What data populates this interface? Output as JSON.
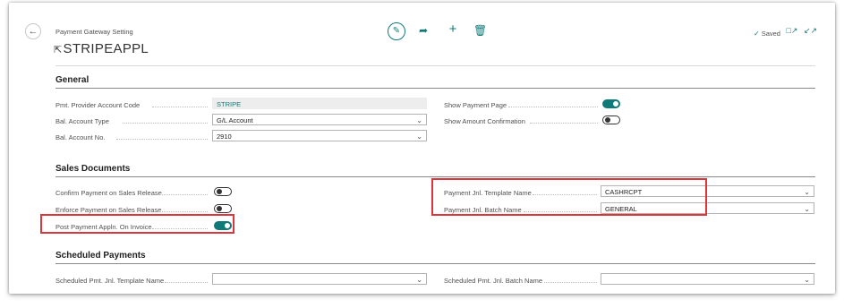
{
  "header": {
    "page_caption": "Payment Gateway Setting",
    "record_title": "STRIPEAPPL",
    "saved_text": "Saved",
    "icons": [
      "back-arrow-icon",
      "edit-icon",
      "share-icon",
      "add-icon",
      "delete-icon",
      "saved-check-icon",
      "open-new-window-icon",
      "collapse-icon"
    ]
  },
  "colors": {
    "accent": "#0f7b79",
    "highlight": "#d9363e"
  },
  "general": {
    "title": "General",
    "provider_label": "Pmt. Provider Account Code",
    "provider_value": "STRIPE",
    "bal_type_label": "Bal. Account Type",
    "bal_type_value": "G/L Account",
    "bal_no_label": "Bal. Account No.",
    "bal_no_value": "2910",
    "show_page_label": "Show Payment Page",
    "show_page_on": true,
    "show_amount_label": "Show Amount Confirmation",
    "show_amount_on": false
  },
  "sales": {
    "title": "Sales Documents",
    "confirm_label": "Confirm Payment on Sales Release",
    "confirm_on": false,
    "enforce_label": "Enforce Payment on Sales Release",
    "enforce_on": false,
    "post_label": "Post Payment Appln. On Invoice",
    "post_on": true,
    "template_label": "Payment Jnl. Template Name",
    "template_value": "CASHRCPT",
    "batch_label": "Payment Jnl. Batch Name",
    "batch_value": "GENERAL"
  },
  "scheduled": {
    "title": "Scheduled Payments",
    "template_label": "Scheduled Pmt. Jnl. Template Name",
    "template_value": "",
    "batch_label": "Scheduled Pmt. Jnl. Batch Name",
    "batch_value": ""
  }
}
